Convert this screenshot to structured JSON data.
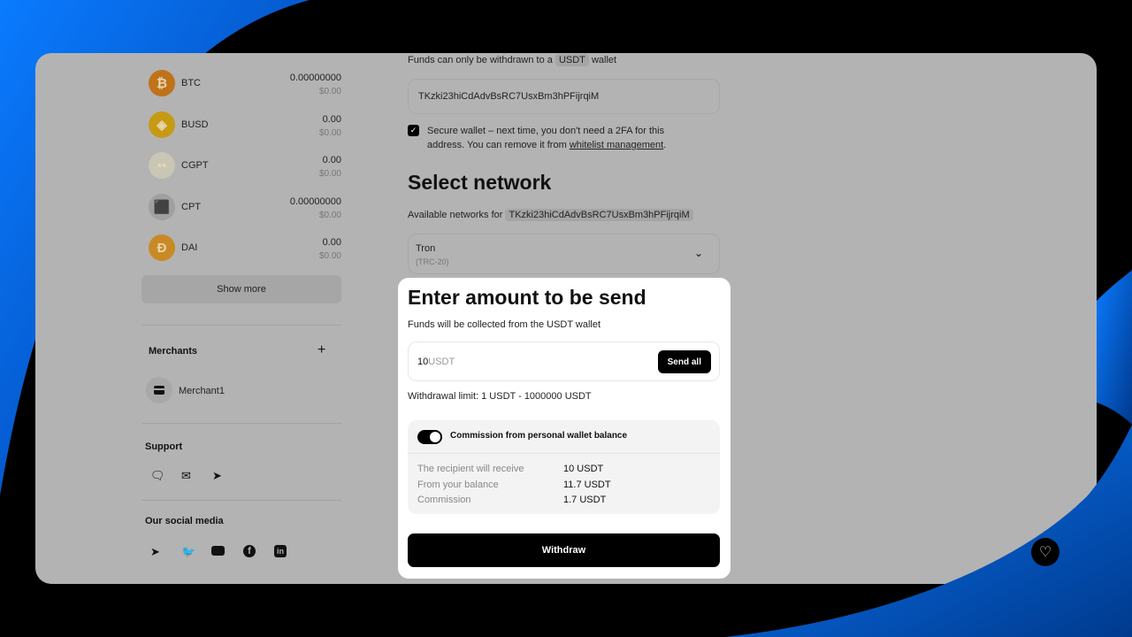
{
  "colors": {
    "accent": "#000000",
    "panel": "#b3b3b3",
    "swoosh": "#0a6cff"
  },
  "coins": [
    {
      "symbol": "BTC",
      "amount": "0.00000000",
      "usd": "$0.00",
      "icon": "bitcoin-icon",
      "color": "#c0721a"
    },
    {
      "symbol": "BUSD",
      "amount": "0.00",
      "usd": "$0.00",
      "icon": "busd-icon",
      "color": "#c79a14"
    },
    {
      "symbol": "CGPT",
      "amount": "0.00",
      "usd": "$0.00",
      "icon": "cgpt-icon",
      "color": "#c9c6b6"
    },
    {
      "symbol": "CPT",
      "amount": "0.00000000",
      "usd": "$0.00",
      "icon": "cube-icon",
      "color": "#a0a0a0"
    },
    {
      "symbol": "DAI",
      "amount": "0.00",
      "usd": "$0.00",
      "icon": "dai-icon",
      "color": "#c98a25"
    }
  ],
  "sidebar": {
    "show_more": "Show more",
    "merchants_title": "Merchants",
    "merchant": "Merchant1",
    "support_title": "Support",
    "social_title": "Our social media"
  },
  "wallet": {
    "notice_pre": "Funds can only be withdrawn to a",
    "currency": "USDT",
    "notice_post": "wallet",
    "address": "TKzki23hiCdAdvBsRC7UsxBm3hPFijrqiM",
    "secure_text": "Secure wallet – next time, you don't need a 2FA for this address. You can remove it from",
    "secure_link": "whitelist management",
    "secure_end": "."
  },
  "network": {
    "title": "Select network",
    "available_label": "Available networks for",
    "address": "TKzki23hiCdAdvBsRC7UsxBm3hPFijrqiM",
    "selected": "Tron",
    "selected_sub": "(TRC-20)"
  },
  "amount": {
    "title": "Enter amount to be send",
    "subtitle": "Funds will be collected from the USDT wallet",
    "value": "10",
    "unit": "USDT",
    "send_all": "Send all",
    "limit": "Withdrawal limit:  1 USDT - 1000000 USDT"
  },
  "commission": {
    "toggle_label": "Commission from personal wallet balance",
    "toggle_on": true,
    "rows": [
      {
        "label": "The recipient will receive",
        "value": "10 USDT"
      },
      {
        "label": "From your balance",
        "value": "11.7 USDT"
      },
      {
        "label": "Commission",
        "value": "1.7 USDT"
      }
    ]
  },
  "withdraw": "Withdraw"
}
